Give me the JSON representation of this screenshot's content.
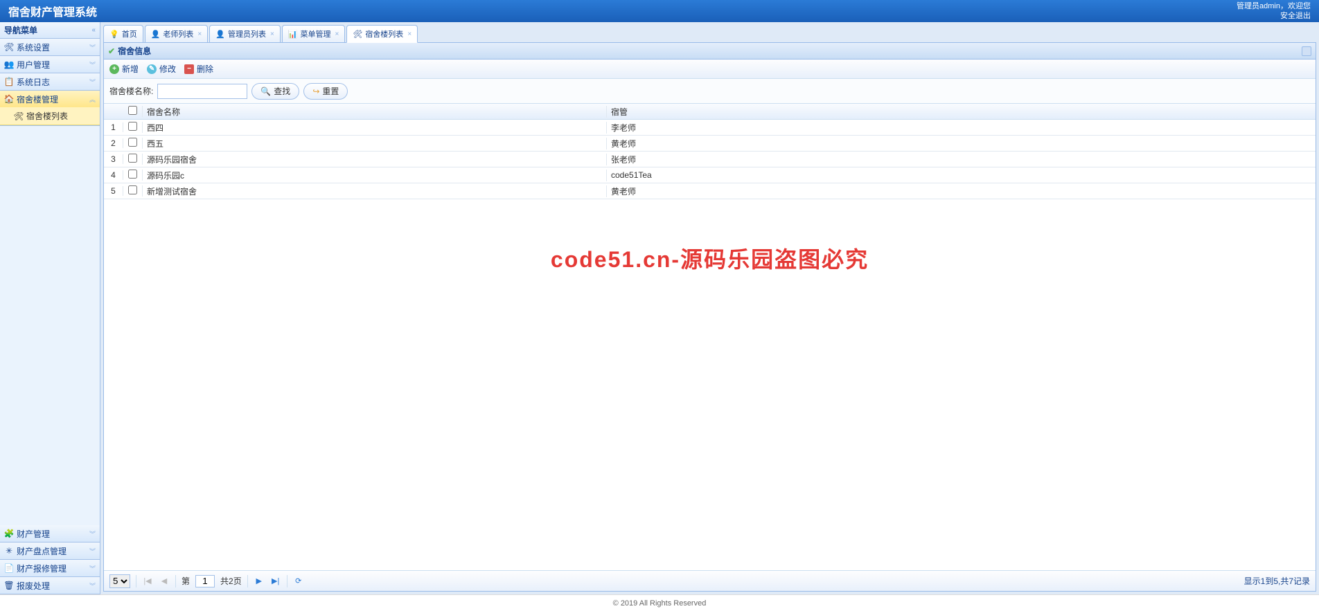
{
  "header": {
    "title": "宿舍财产管理系统",
    "admin_label": "管理员admin，欢迎您",
    "logout_label": "安全退出"
  },
  "sidebar": {
    "title": "导航菜单",
    "groups": [
      {
        "label": "系统设置",
        "icon": "🛠"
      },
      {
        "label": "用户管理",
        "icon": "👥"
      },
      {
        "label": "系统日志",
        "icon": "📋"
      },
      {
        "label": "宿舍楼管理",
        "icon": "🏠",
        "active": true
      },
      {
        "label": "财产管理",
        "icon": "🧩"
      },
      {
        "label": "财产盘点管理",
        "icon": "✳"
      },
      {
        "label": "财产报修管理",
        "icon": "📄"
      },
      {
        "label": "报废处理",
        "icon": "🗑"
      }
    ],
    "active_item": "宿舍楼列表"
  },
  "tabs": [
    {
      "label": "首页",
      "icon": "💡",
      "closable": false
    },
    {
      "label": "老师列表",
      "icon": "👤",
      "closable": true
    },
    {
      "label": "管理员列表",
      "icon": "👤",
      "closable": true
    },
    {
      "label": "菜单管理",
      "icon": "📊",
      "closable": true
    },
    {
      "label": "宿舍楼列表",
      "icon": "🛠",
      "closable": true,
      "active": true
    }
  ],
  "panel": {
    "title": "宿舍信息",
    "toolbar": {
      "add": "新增",
      "edit": "修改",
      "delete": "删除"
    },
    "search": {
      "label": "宿舍楼名称:",
      "find": "查找",
      "reset": "重置"
    },
    "columns": {
      "name": "宿舍名称",
      "manager": "宿管"
    },
    "rows": [
      {
        "num": "1",
        "name": "西四",
        "manager": "李老师"
      },
      {
        "num": "2",
        "name": "西五",
        "manager": "黄老师"
      },
      {
        "num": "3",
        "name": "源码乐园宿舍",
        "manager": "张老师"
      },
      {
        "num": "4",
        "name": "源码乐园c",
        "manager": "code51Tea"
      },
      {
        "num": "5",
        "name": "新增测试宿舍",
        "manager": "黄老师"
      }
    ]
  },
  "watermark": "code51.cn-源码乐园盗图必究",
  "pager": {
    "page_size": "5",
    "page_label_prefix": "第",
    "page_current": "1",
    "page_total_label": "共2页",
    "info": "显示1到5,共7记录"
  },
  "footer": "© 2019 All Rights Reserved"
}
